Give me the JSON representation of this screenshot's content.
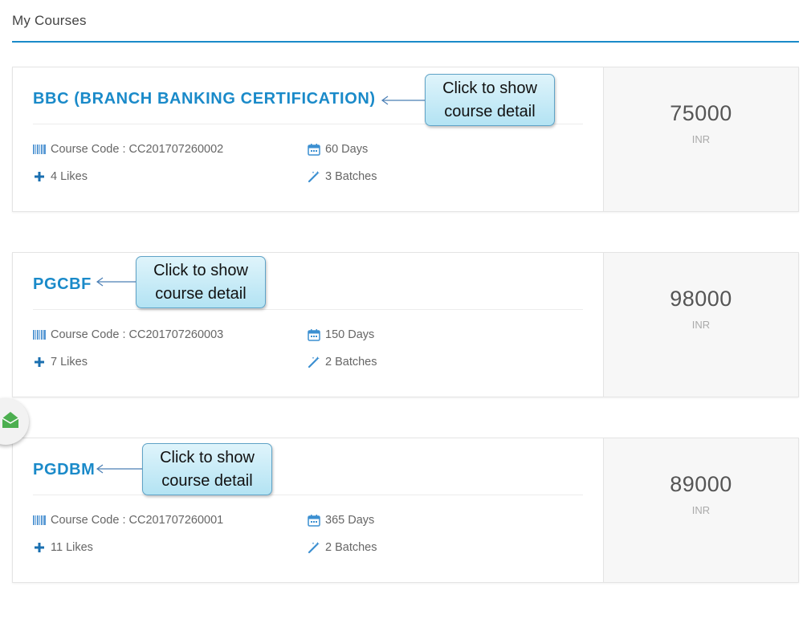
{
  "section": {
    "title": "My Courses"
  },
  "courses": [
    {
      "title": "BBC (BRANCH BANKING CERTIFICATION)",
      "code_label": "Course Code : CC201707260002",
      "duration": "60 Days",
      "likes": "4 Likes",
      "batches": "3 Batches",
      "price": "75000",
      "currency": "INR"
    },
    {
      "title": "PGCBF",
      "code_label": "Course Code : CC201707260003",
      "duration": "150 Days",
      "likes": "7 Likes",
      "batches": "2 Batches",
      "price": "98000",
      "currency": "INR"
    },
    {
      "title": "PGDBM",
      "code_label": "Course Code : CC201707260001",
      "duration": "365 Days",
      "likes": "11 Likes",
      "batches": "2 Batches",
      "price": "89000",
      "currency": "INR"
    }
  ],
  "callouts": [
    {
      "line1": "Click to show",
      "line2": "course detail"
    },
    {
      "line1": "Click to show",
      "line2": "course detail"
    },
    {
      "line1": "Click to show",
      "line2": "course detail"
    }
  ],
  "icons": {
    "code": "barcode-icon",
    "duration": "calendar-icon",
    "likes": "plus-icon",
    "batches": "magic-wand-icon",
    "fab": "envelope-icon"
  },
  "colors": {
    "accent": "#1a8ac9",
    "callout": "#b3e3f3",
    "fab_icon": "#4caf50"
  }
}
